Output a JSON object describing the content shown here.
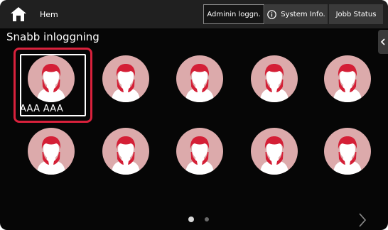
{
  "header": {
    "home_label": "Hem",
    "admin_label": "Adminin loggn.",
    "sysinfo_label": "System Info.",
    "jobb_label": "Jobb Status"
  },
  "section": {
    "title": "Snabb inloggning"
  },
  "users": [
    {
      "name": "AAA AAA",
      "selected": true
    },
    {
      "name": "",
      "selected": false
    },
    {
      "name": "",
      "selected": false
    },
    {
      "name": "",
      "selected": false
    },
    {
      "name": "",
      "selected": false
    },
    {
      "name": "",
      "selected": false
    },
    {
      "name": "",
      "selected": false
    },
    {
      "name": "",
      "selected": false
    },
    {
      "name": "",
      "selected": false
    },
    {
      "name": "",
      "selected": false
    }
  ],
  "pager": {
    "current_page": 1,
    "page_count": 2
  },
  "colors": {
    "selection": "#d9213c",
    "avatar_bg": "#dcaaab",
    "avatar_hair": "#d41f36",
    "topbar": "#202020"
  },
  "icons": {
    "home": "home-icon",
    "info": "info-icon",
    "side_tab": "chevron-left-icon",
    "next": "chevron-right-icon",
    "avatar": "user-avatar-icon"
  }
}
